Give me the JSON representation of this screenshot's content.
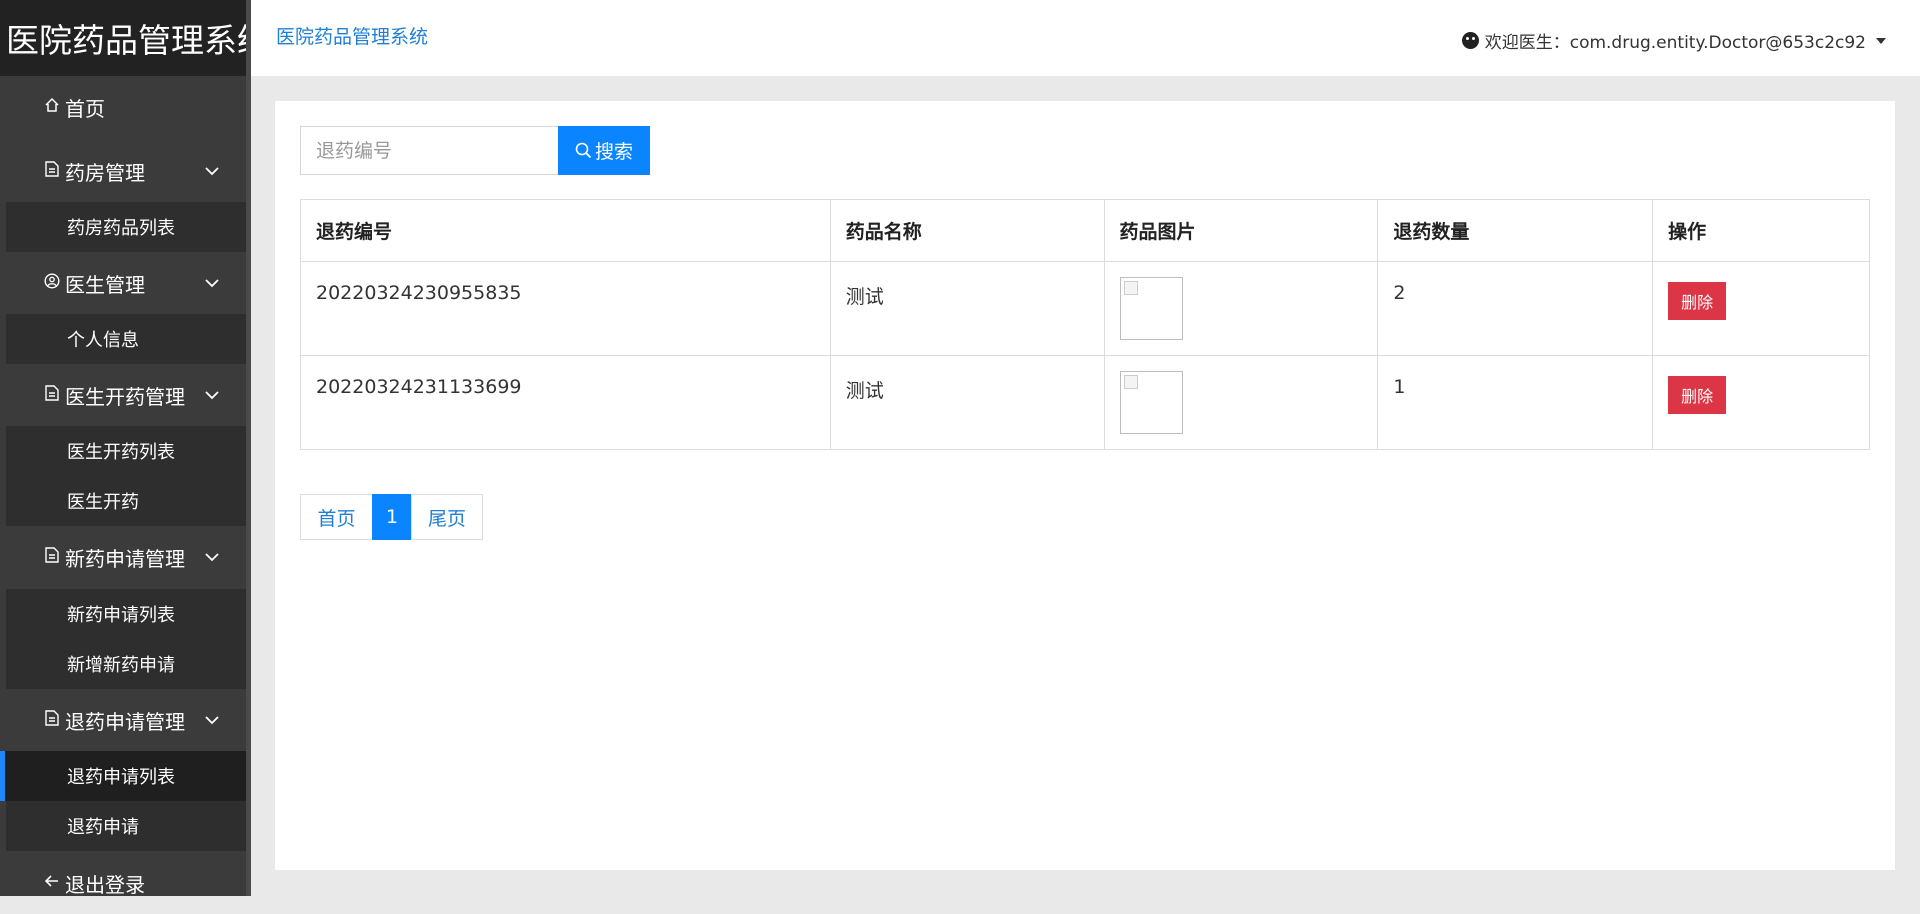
{
  "brand": "医院药品管理系统",
  "header": {
    "title": "医院药品管理系统",
    "user": "欢迎医生：com.drug.entity.Doctor@653c2c92"
  },
  "sidebar": {
    "home": "首页",
    "pharmacy": {
      "label": "药房管理",
      "items": [
        "药房药品列表"
      ]
    },
    "doctor": {
      "label": "医生管理",
      "items": [
        "个人信息"
      ]
    },
    "prescribe": {
      "label": "医生开药管理",
      "items": [
        "医生开药列表",
        "医生开药"
      ]
    },
    "newdrug": {
      "label": "新药申请管理",
      "items": [
        "新药申请列表",
        "新增新药申请"
      ]
    },
    "refund": {
      "label": "退药申请管理",
      "items": [
        "退药申请列表",
        "退药申请"
      ]
    },
    "logout": "退出登录"
  },
  "search": {
    "placeholder": "退药编号",
    "button": "搜索"
  },
  "table": {
    "headers": [
      "退药编号",
      "药品名称",
      "药品图片",
      "退药数量",
      "操作"
    ],
    "rows": [
      {
        "code": "20220324230955835",
        "name": "测试",
        "qty": "2",
        "action": "删除"
      },
      {
        "code": "20220324231133699",
        "name": "测试",
        "qty": "1",
        "action": "删除"
      }
    ]
  },
  "pagination": {
    "first": "首页",
    "current": "1",
    "last": "尾页"
  }
}
